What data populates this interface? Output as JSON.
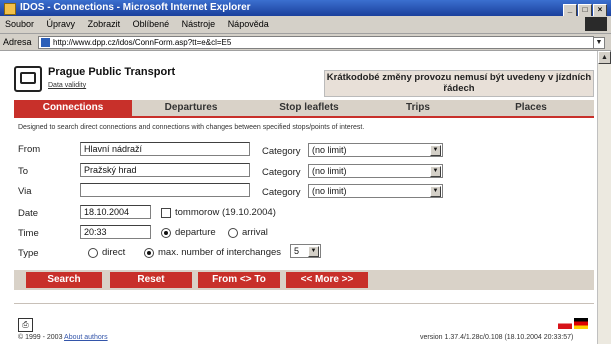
{
  "window": {
    "title": "IDOS - Connections - Microsoft Internet Explorer",
    "btn_min": "_",
    "btn_max": "□",
    "btn_close": "×"
  },
  "menu": [
    "Soubor",
    "Úpravy",
    "Zobrazit",
    "Oblíbené",
    "Nástroje",
    "Nápověda"
  ],
  "address": {
    "label": "Adresa",
    "url": "http://www.dpp.cz/idos/ConnForm.asp?tt=e&cl=E5"
  },
  "site": {
    "title": "Prague Public Transport",
    "subtitle": "Data validity",
    "notice": "Krátkodobé změny provozu nemusí být uvedeny v jízdních řádech"
  },
  "tabs": [
    "Connections",
    "Departures",
    "Stop leaflets",
    "Trips",
    "Places"
  ],
  "description": "Designed to search direct connections and connections with changes between specified stops/points of interest.",
  "form": {
    "from_label": "From",
    "from_value": "Hlavní nádraží",
    "to_label": "To",
    "to_value": "Pražský hrad",
    "via_label": "Via",
    "via_value": "",
    "category_label": "Category",
    "category_from": "(no limit)",
    "category_to": "(no limit)",
    "category_via": "(no limit)",
    "date_label": "Date",
    "date_value": "18.10.2004",
    "tomorrow_label": "tommorow (19.10.2004)",
    "time_label": "Time",
    "time_value": "20:33",
    "departure_label": "departure",
    "arrival_label": "arrival",
    "type_label": "Type",
    "direct_label": "direct",
    "interchanges_label": "max. number of interchanges",
    "interchanges_value": "5"
  },
  "buttons": {
    "search": "Search",
    "reset": "Reset",
    "from_to": "From <> To",
    "more": "<< More >>"
  },
  "footer": {
    "copyright": "© 1999 - 2003",
    "about": "About authors",
    "version": "version 1.37.4/1.28c/0.108 (18.10.2004 20:33:57)"
  }
}
